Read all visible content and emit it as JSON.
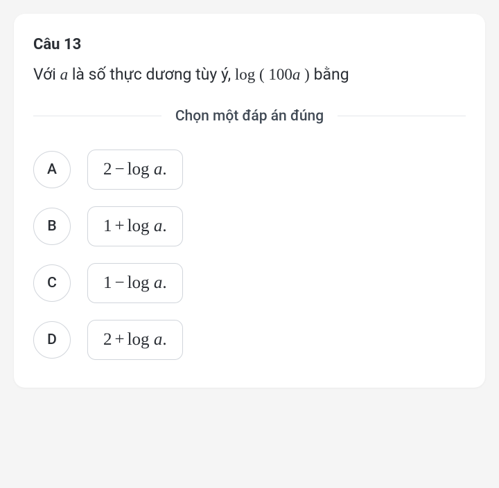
{
  "question": {
    "title": "Câu 13",
    "prefix": "Với ",
    "var": "a",
    "mid": " là số thực dương tùy ý, ",
    "logop": "log",
    "lparen": " ( ",
    "arg_num": "100",
    "arg_var": "a",
    "rparen": " ) ",
    "suffix": " bằng"
  },
  "instruction": "Chọn một đáp án đúng",
  "answers": [
    {
      "letter": "A",
      "num": "2",
      "op": "−",
      "logtxt": "log",
      "var": "a",
      "dot": "."
    },
    {
      "letter": "B",
      "num": "1",
      "op": "+",
      "logtxt": "log",
      "var": "a",
      "dot": "."
    },
    {
      "letter": "C",
      "num": "1",
      "op": "−",
      "logtxt": "log",
      "var": "a",
      "dot": "."
    },
    {
      "letter": "D",
      "num": "2",
      "op": "+",
      "logtxt": "log",
      "var": "a",
      "dot": "."
    }
  ]
}
